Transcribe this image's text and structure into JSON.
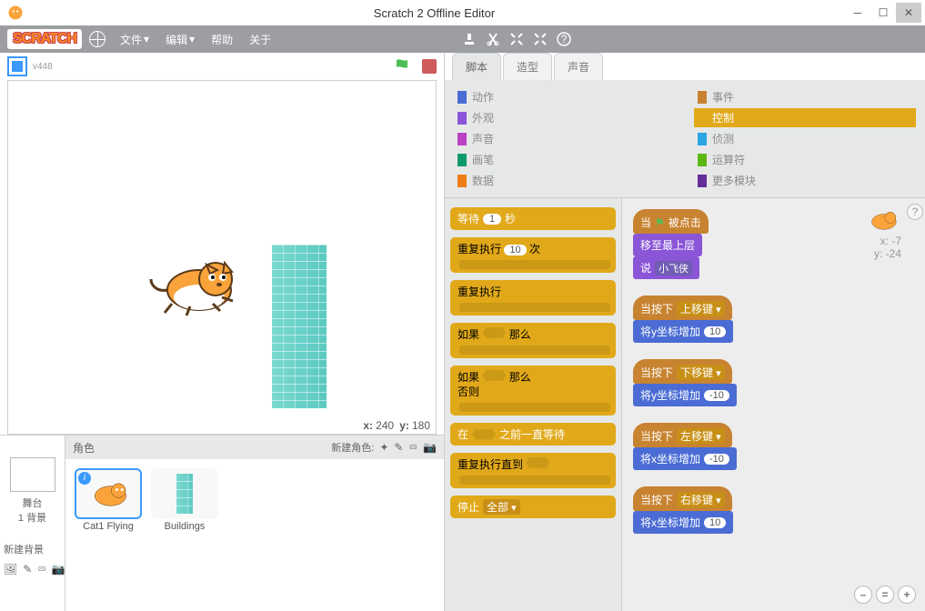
{
  "title": "Scratch 2 Offline Editor",
  "logo": "SCRATCH",
  "menus": {
    "file": "文件",
    "edit": "编辑",
    "help": "帮助",
    "about": "关于"
  },
  "version": "v448",
  "coords": {
    "xl": "x:",
    "xv": "240",
    "yl": "y:",
    "yv": "180"
  },
  "spriteHeader": {
    "label": "角色",
    "newLabel": "新建角色:"
  },
  "backdrop": {
    "stage": "舞台",
    "count": "1 背景",
    "new": "新建背景"
  },
  "sprites": {
    "s1": "Cat1 Flying",
    "s2": "Buildings"
  },
  "tabs": {
    "scripts": "脚本",
    "costumes": "造型",
    "sounds": "声音"
  },
  "cats": {
    "motion": "动作",
    "looks": "外观",
    "sound": "声音",
    "pen": "画笔",
    "data": "数据",
    "events": "事件",
    "control": "控制",
    "sensing": "侦测",
    "operators": "运算符",
    "more": "更多模块"
  },
  "palette": {
    "wait1": "等待",
    "wait2": "秒",
    "waitv": "1",
    "repeat1": "重复执行",
    "repeat2": "次",
    "repeatv": "10",
    "forever": "重复执行",
    "if1": "如果",
    "if2": "那么",
    "else": "否则",
    "until1": "在",
    "until2": "之前一直等待",
    "repuntil": "重复执行直到",
    "stop": "停止",
    "stopv": "全部"
  },
  "scripts": {
    "hat1a": "当",
    "hat1b": "被点击",
    "front": "移至最上层",
    "say": "说",
    "sayv": "小飞侠",
    "keyhat": "当按下",
    "kup": "上移键",
    "kdown": "下移键",
    "kleft": "左移键",
    "kright": "右移键",
    "chy": "将y坐标增加",
    "chx": "将x坐标增加",
    "v10": "10",
    "vm10": "-10"
  },
  "info": {
    "x": "x: -7",
    "y": "y: -24"
  }
}
